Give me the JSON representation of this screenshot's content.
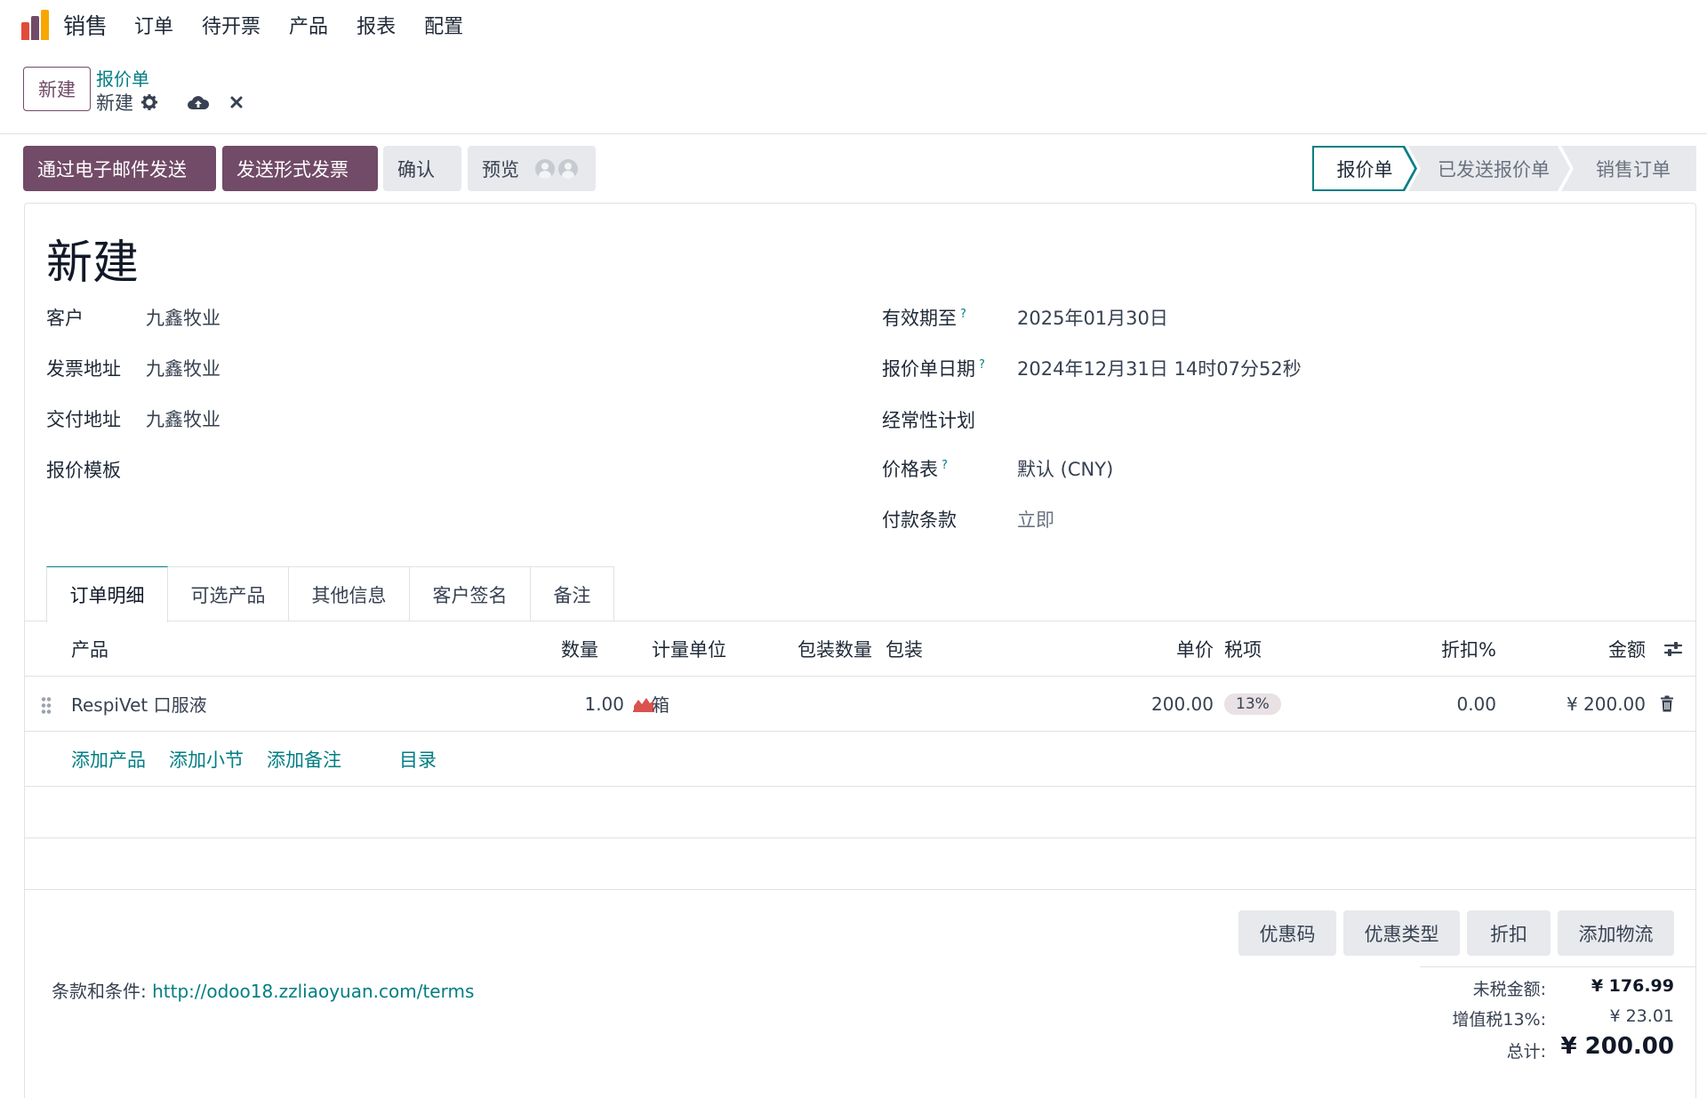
{
  "nav": {
    "app_name": "销售",
    "menu": [
      "订单",
      "待开票",
      "产品",
      "报表",
      "配置"
    ],
    "logo_colors": [
      "#e14b39",
      "#714b67",
      "#f7a700"
    ]
  },
  "control": {
    "new_button": "新建",
    "breadcrumb": "报价单",
    "record_name": "新建"
  },
  "actions": {
    "send_email": "通过电子邮件发送",
    "send_proforma": "发送形式发票",
    "confirm": "确认",
    "preview": "预览"
  },
  "status": {
    "stages": [
      "报价单",
      "已发送报价单",
      "销售订单"
    ],
    "active": "报价单"
  },
  "form": {
    "title": "新建",
    "left": [
      {
        "label": "客户",
        "value": "九鑫牧业"
      },
      {
        "label": "发票地址",
        "value": "九鑫牧业"
      },
      {
        "label": "交付地址",
        "value": "九鑫牧业"
      },
      {
        "label": "报价模板",
        "value": ""
      }
    ],
    "right": [
      {
        "label": "有效期至",
        "help": "?",
        "value": "2025年01月30日"
      },
      {
        "label": "报价单日期",
        "help": "?",
        "value": "2024年12月31日 14时07分52秒"
      },
      {
        "label": "经常性计划",
        "help": "",
        "value": ""
      },
      {
        "label": "价格表",
        "help": "?",
        "value": "默认 (CNY)"
      },
      {
        "label": "付款条款",
        "help": "",
        "value": "立即"
      }
    ]
  },
  "tabs": [
    "订单明细",
    "可选产品",
    "其他信息",
    "客户签名",
    "备注"
  ],
  "table": {
    "headers": {
      "product": "产品",
      "qty": "数量",
      "uom": "计量单位",
      "pack_qty": "包装数量",
      "packaging": "包装",
      "price": "单价",
      "taxes": "税项",
      "discount": "折扣%",
      "amount": "金额"
    },
    "rows": [
      {
        "product": "RespiVet 口服液",
        "qty": "1.00",
        "uom": "箱",
        "price": "200.00",
        "tax": "13%",
        "discount": "0.00",
        "amount": "¥ 200.00"
      }
    ],
    "add_links": [
      "添加产品",
      "添加小节",
      "添加备注",
      "目录"
    ]
  },
  "footer": {
    "buttons": [
      "优惠码",
      "优惠类型",
      "折扣",
      "添加物流"
    ],
    "terms_label": "条款和条件:",
    "terms_url": "http://odoo18.zzliaoyuan.com/terms",
    "totals": {
      "untaxed_label": "未税金额:",
      "untaxed_value": "¥ 176.99",
      "tax_label": "增值税13%:",
      "tax_value": "¥ 23.01",
      "total_label": "总计:",
      "total_value": "¥ 200.00"
    }
  }
}
